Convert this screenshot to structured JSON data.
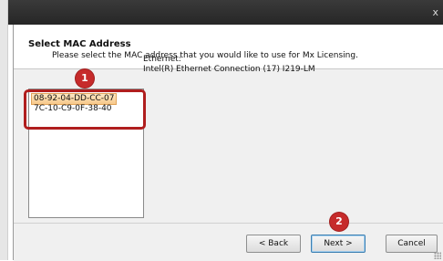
{
  "window": {
    "close_glyph": "x"
  },
  "header": {
    "title": "Select MAC Address",
    "subtitle": "Please select the MAC address that you would like to use for Mx Licensing."
  },
  "mac_list": {
    "items": [
      {
        "label": "08-92-04-DD-CC-07",
        "selected": true
      },
      {
        "label": "7C-10-C9-0F-38-40",
        "selected": false
      }
    ]
  },
  "details": {
    "line1": "Ethernet:",
    "line2": "Intel(R) Ethernet Connection (17) I219-LM"
  },
  "buttons": {
    "back": "< Back",
    "next": "Next >",
    "cancel": "Cancel"
  },
  "annotations": {
    "badge1": "1",
    "badge2": "2",
    "color": "#c62b2b"
  }
}
